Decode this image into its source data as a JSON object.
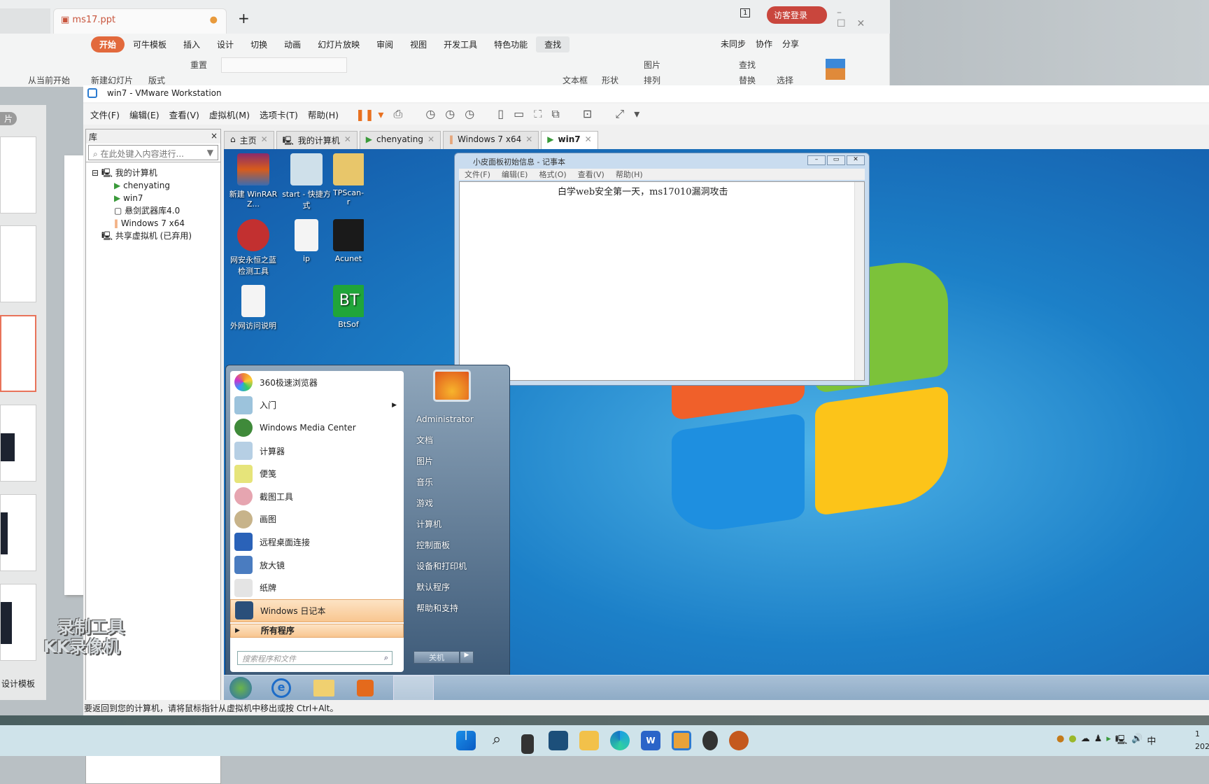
{
  "wps": {
    "doc_tab": "ms17.ppt",
    "visitor_login": "访客登录",
    "page_indicator": "1",
    "ribbon_tabs": [
      "开始",
      "可牛模板",
      "插入",
      "设计",
      "切换",
      "动画",
      "幻灯片放映",
      "审阅",
      "视图",
      "开发工具",
      "特色功能",
      "查找"
    ],
    "right_actions": [
      "未同步",
      "协作",
      "分享"
    ],
    "tools": [
      "从当前开始",
      "新建幻灯片",
      "版式",
      "重置",
      "文本框",
      "形状",
      "图片",
      "排列",
      "查找",
      "替换",
      "选择"
    ],
    "left_label": "片",
    "design_template": "设计模板"
  },
  "vmware": {
    "title": "win7 - VMware Workstation",
    "menu": [
      "文件(F)",
      "编辑(E)",
      "查看(V)",
      "虚拟机(M)",
      "选项卡(T)",
      "帮助(H)"
    ],
    "library": {
      "title": "库",
      "close": "×",
      "search_placeholder": "在此处键入内容进行...",
      "tree": [
        "我的计算机",
        "chenyating",
        "win7",
        "悬剑武器库4.0",
        "Windows 7 x64",
        "共享虚拟机 (已弃用)"
      ]
    },
    "tabs": [
      "主页",
      "我的计算机",
      "chenyating",
      "Windows 7 x64",
      "win7"
    ],
    "active_tab": "win7",
    "status": "要返回到您的计算机，请将鼠标指针从虚拟机中移出或按 Ctrl+Alt。"
  },
  "desktop": {
    "icons": [
      "新建 WinRAR Z...",
      "start - 快捷方式",
      "TPScan-r",
      "网安永恒之蓝检测工具",
      "ip",
      "Acunet",
      "外网访问说明",
      "BtSof"
    ]
  },
  "notepad": {
    "title": "小皮面板初始信息 - 记事本",
    "menu": [
      "文件(F)",
      "编辑(E)",
      "格式(O)",
      "查看(V)",
      "帮助(H)"
    ],
    "content": "白学web安全第一天，ms17010漏洞攻击"
  },
  "start_menu": {
    "programs": [
      "360极速浏览器",
      "入门",
      "Windows Media Center",
      "计算器",
      "便笺",
      "截图工具",
      "画图",
      "远程桌面连接",
      "放大镜",
      "纸牌",
      "Windows 日记本"
    ],
    "highlighted": "Windows 日记本",
    "all_programs": "所有程序",
    "search_placeholder": "搜索程序和文件",
    "right": [
      "Administrator",
      "文档",
      "图片",
      "音乐",
      "游戏",
      "计算机",
      "控制面板",
      "设备和打印机",
      "默认程序",
      "帮助和支持"
    ],
    "shutdown": "关机"
  },
  "tray": {
    "ime": "中",
    "time": "1",
    "date": "202"
  },
  "watermark": {
    "line1": "录制工具",
    "line2": "KK录像机"
  },
  "colors": {
    "wps_accent": "#e2693c",
    "win7_desktop": "#1c80c8",
    "highlight": "#f8c690"
  }
}
